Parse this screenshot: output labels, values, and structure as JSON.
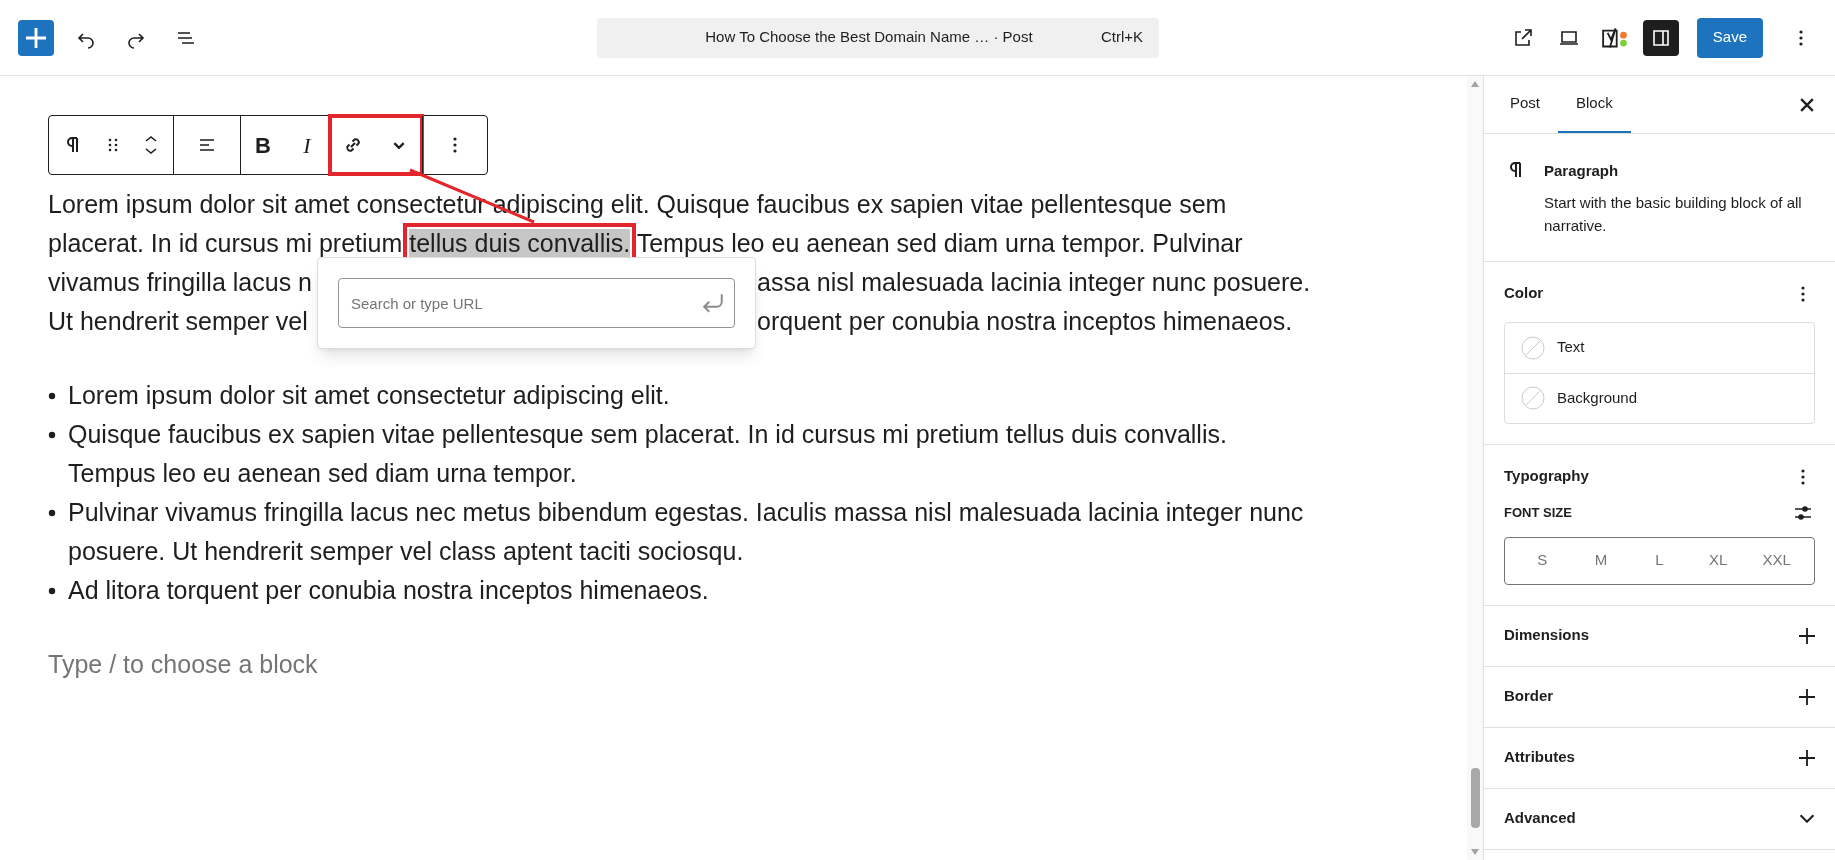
{
  "topbar": {
    "left_tools": [
      {
        "kind": "add"
      },
      {
        "kind": "undo"
      },
      {
        "kind": "redo"
      },
      {
        "kind": "list"
      }
    ],
    "command_bar": {
      "title": "How To Choose the Best Domain Name … · Post",
      "shortcut": "Ctrl+K"
    },
    "right_tools": [
      {
        "kind": "external",
        "pressed": false
      },
      {
        "kind": "preview",
        "pressed": false
      },
      {
        "kind": "seo",
        "pressed": false
      },
      {
        "kind": "sidebar",
        "pressed": true
      }
    ],
    "save_label": "Save"
  },
  "block_toolbar": [
    {
      "annotated": false,
      "tools": [
        {
          "kind": "paragraph"
        },
        {
          "kind": "drag"
        },
        {
          "kind": "move"
        }
      ]
    },
    {
      "annotated": false,
      "tools": [
        {
          "kind": "align"
        }
      ]
    },
    {
      "annotated": false,
      "tools": [
        {
          "kind": "bold",
          "label": "B"
        },
        {
          "kind": "italic",
          "label": "I"
        }
      ]
    },
    {
      "annotated": true,
      "tools": [
        {
          "kind": "link"
        },
        {
          "kind": "chevron"
        }
      ]
    },
    {
      "annotated": false,
      "tools": [
        {
          "kind": "more"
        }
      ]
    }
  ],
  "paragraph_lines": [
    {
      "left": [
        {
          "text": "Lorem ipsum dolor sit amet consectetur adipiscing elit. Quisque faucibus ex sapien vitae pellentesque sem",
          "selected": false
        }
      ]
    },
    {
      "left": [
        {
          "text": "placerat. In id cursus mi pretium ",
          "selected": false
        },
        {
          "text": "tellus duis convallis.",
          "selected": true
        },
        {
          "text": " Tempus leo eu aenean sed diam urna tempor. Pulvinar",
          "selected": false
        }
      ]
    },
    {
      "left": [
        {
          "text": "vivamus fringilla lacus n",
          "selected": false
        }
      ],
      "right": "assa nisl malesuada lacinia integer nunc posuere."
    },
    {
      "left": [
        {
          "text": "Ut hendrerit semper vel",
          "selected": false
        }
      ],
      "right": "orquent per conubia nostra inceptos himenaeos."
    }
  ],
  "link_popover": {
    "placeholder": "Search or type URL"
  },
  "list_items": [
    "Lorem ipsum dolor sit amet consectetur adipiscing elit.",
    "Quisque faucibus ex sapien vitae pellentesque sem placerat. In id cursus mi pretium tellus duis convallis. Tempus leo eu aenean sed diam urna tempor.",
    "Pulvinar vivamus fringilla lacus nec metus bibendum egestas. Iaculis massa nisl malesuada lacinia integer nunc posuere. Ut hendrerit semper vel class aptent taciti sociosqu.",
    "Ad litora torquent per conubia nostra inceptos himenaeos."
  ],
  "block_placeholder": "Type / to choose a block",
  "sidebar": {
    "tabs": [
      {
        "label": "Post",
        "selected": false
      },
      {
        "label": "Block",
        "selected": true
      }
    ],
    "block_card": {
      "title": "Paragraph",
      "description": "Start with the basic building block of all narrative."
    },
    "panels": [
      {
        "kind": "color",
        "title": "Color",
        "items": [
          "Text",
          "Background"
        ]
      },
      {
        "kind": "typography",
        "title": "Typography",
        "font_size_label": "FONT SIZE",
        "sizes": [
          {
            "label": "S",
            "selected": false
          },
          {
            "label": "M",
            "selected": false
          },
          {
            "label": "L",
            "selected": false
          },
          {
            "label": "XL",
            "selected": false
          },
          {
            "label": "XXL",
            "selected": false
          }
        ]
      },
      {
        "kind": "addable",
        "title": "Dimensions"
      },
      {
        "kind": "addable",
        "title": "Border"
      },
      {
        "kind": "addable",
        "title": "Attributes"
      },
      {
        "kind": "collapsible",
        "title": "Advanced"
      }
    ]
  }
}
